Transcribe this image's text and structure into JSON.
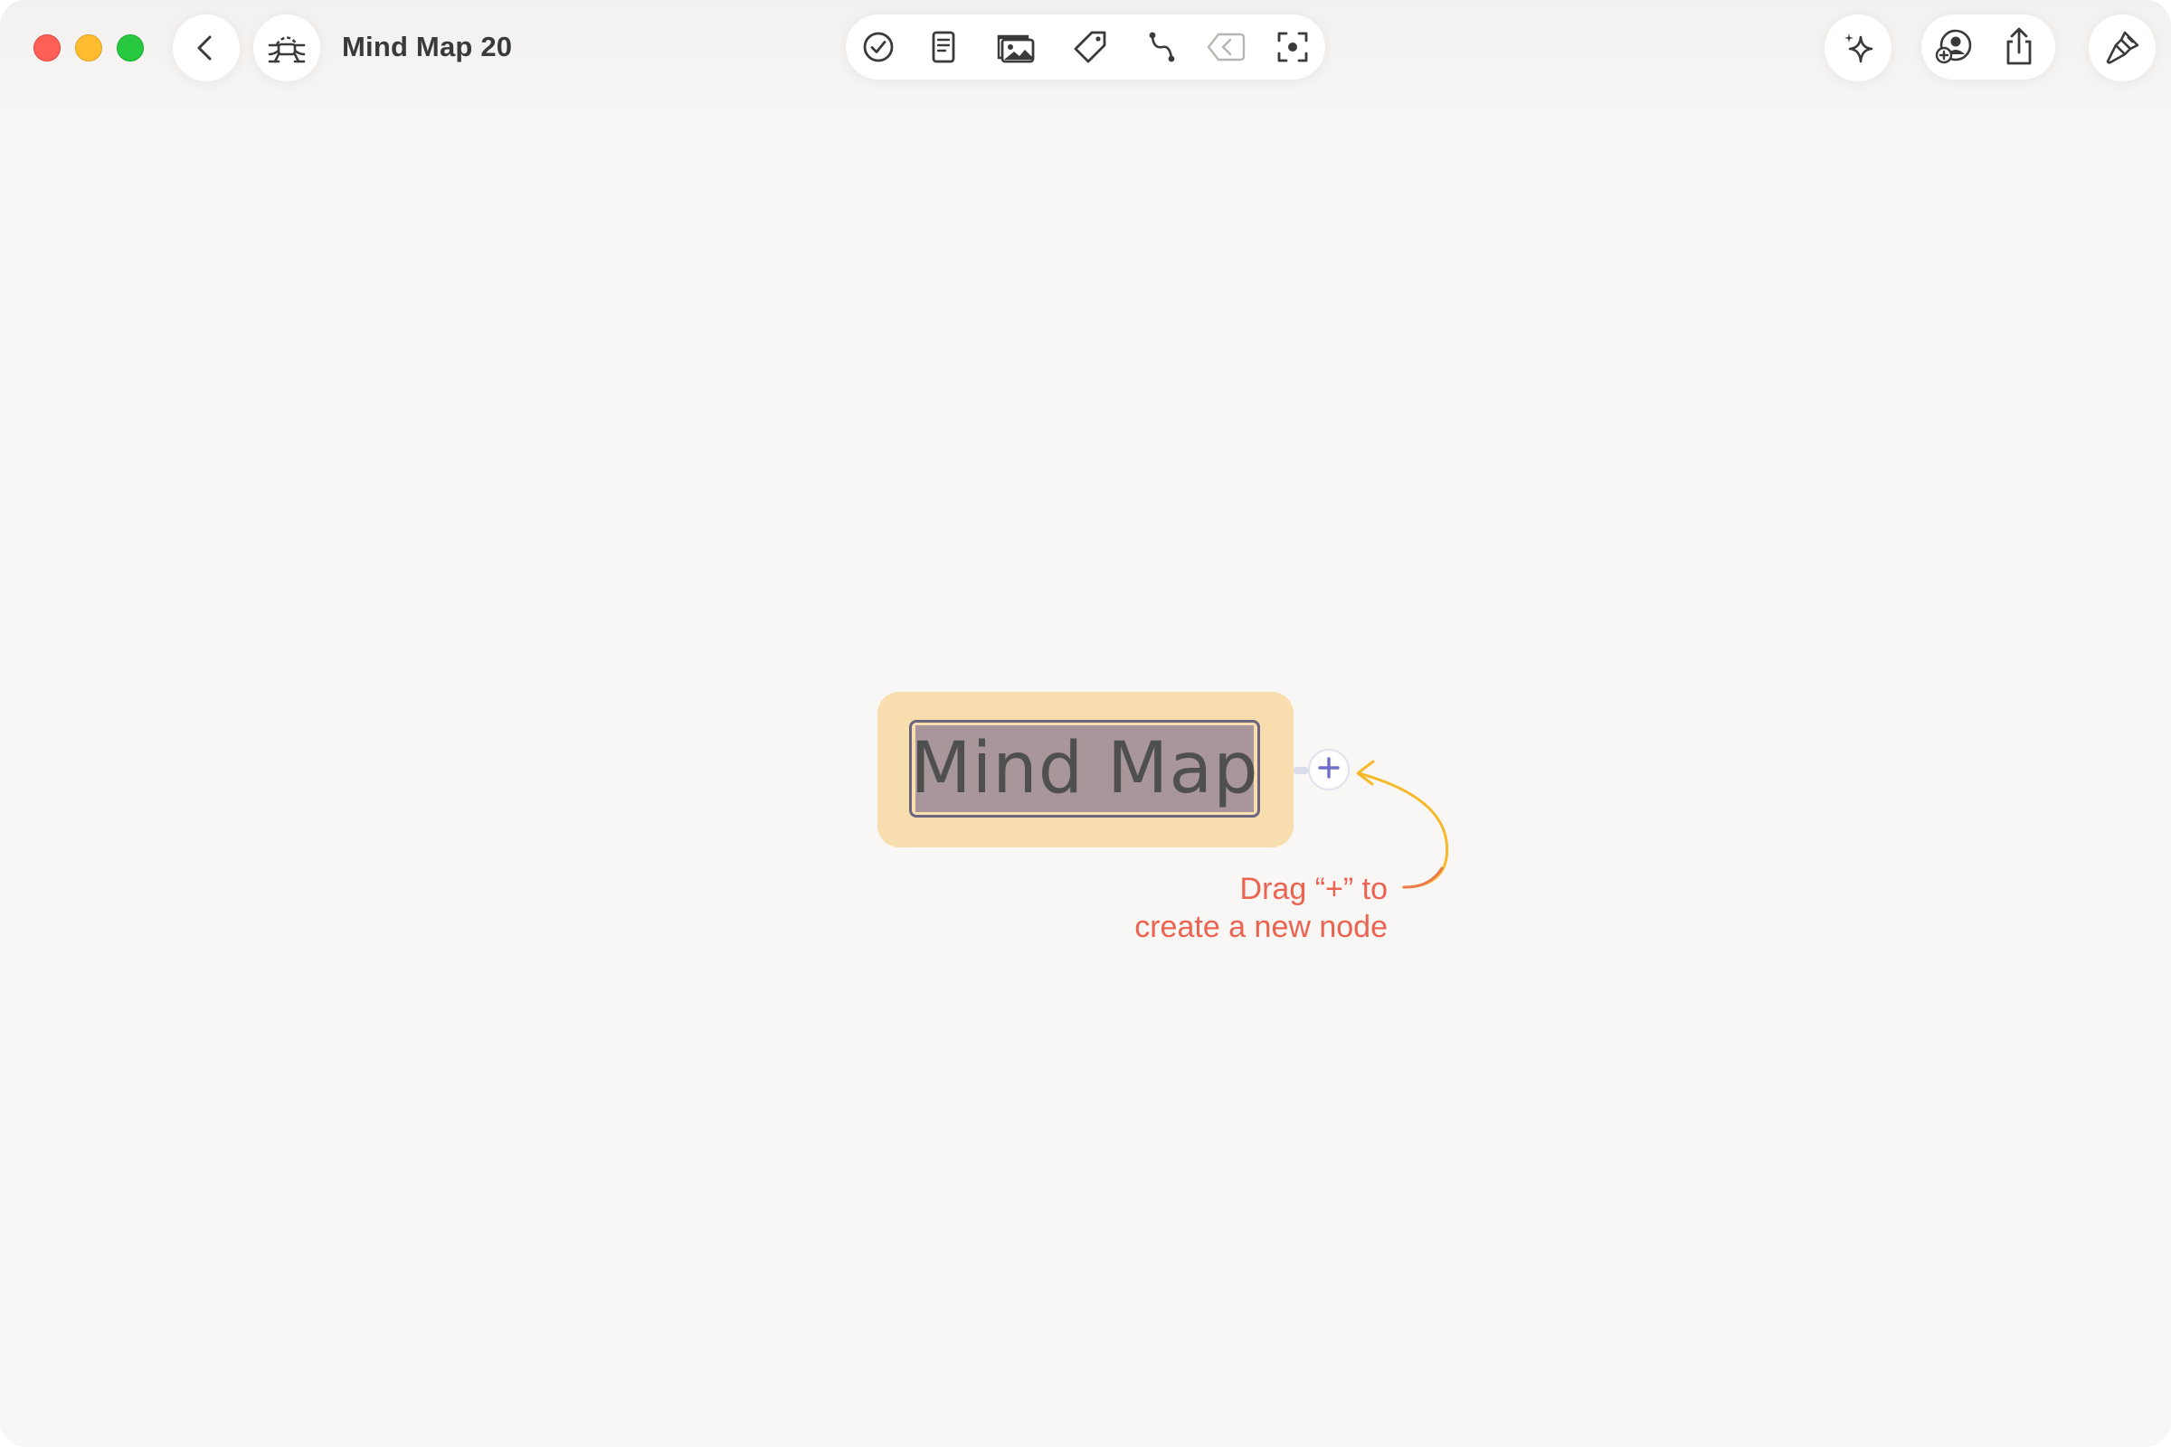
{
  "window": {
    "title": "Mind Map 20",
    "traffic_lights": [
      "close",
      "minimize",
      "zoom"
    ]
  },
  "header": {
    "back_icon": "chevron-left-icon",
    "map_style_icon": "mind-map-style-icon"
  },
  "toolbar": {
    "items": [
      {
        "name": "task-icon"
      },
      {
        "name": "note-icon"
      },
      {
        "name": "image-icon"
      },
      {
        "name": "tag-icon"
      },
      {
        "name": "relationship-icon"
      },
      {
        "name": "back-to-parent-icon"
      },
      {
        "name": "focus-icon"
      }
    ]
  },
  "right_tools": {
    "ai": "sparkle-icon",
    "collaborate": "add-collaborator-icon",
    "share": "share-icon",
    "format": "paintbrush-icon"
  },
  "canvas": {
    "root_node": {
      "text": "Mind Map",
      "fill_color": "#f8ddaf",
      "selection_color": "#a8969b"
    },
    "add_handle": "+",
    "hint_line1": "Drag “+” to",
    "hint_line2": "create a new node",
    "hint_color": "#ec6451",
    "arrow_color": "#f5b92a"
  }
}
